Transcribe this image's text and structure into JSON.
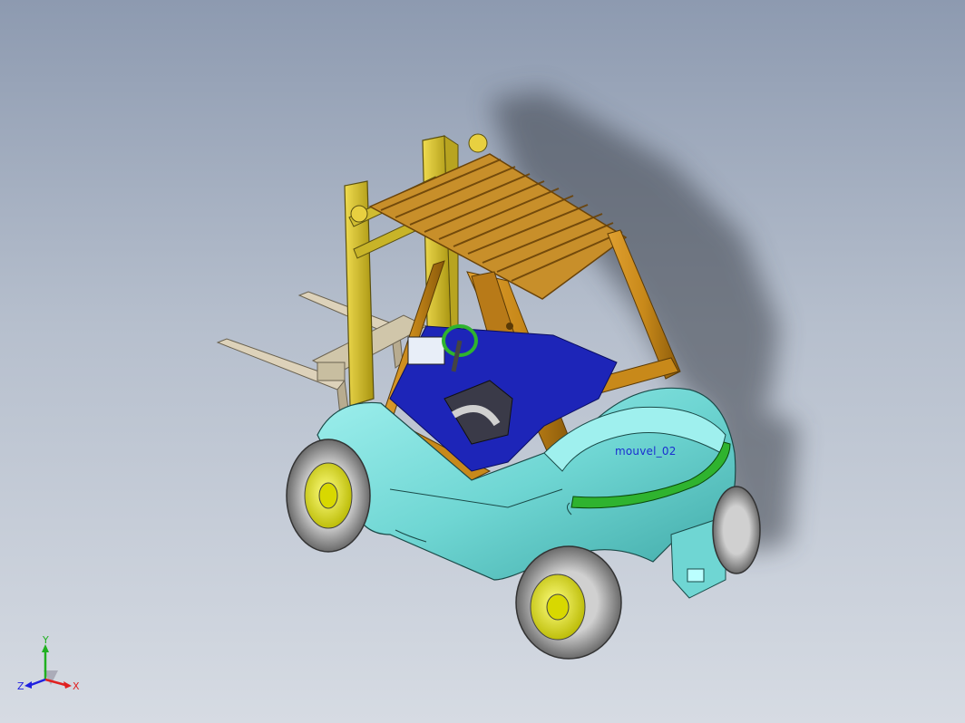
{
  "viewport": {
    "annotation_label": "mouvel_02",
    "colors": {
      "background_top": "#8d9ab0",
      "background_bottom": "#d6dbe3",
      "body": "#6fd6d3",
      "cab_frame": "#c8891a",
      "mast": "#d8c230",
      "floor": "#1d25b8",
      "wheel_rim": "#e6e620",
      "tire": "#8a8a8a",
      "light_strip": "#2fb32f",
      "forks": "#d8ccb2",
      "annotation": "#1b2fd0"
    }
  },
  "triad": {
    "x_label": "X",
    "y_label": "Y",
    "z_label": "Z",
    "x_color": "#e02020",
    "y_color": "#20b020",
    "z_color": "#2020e0"
  }
}
